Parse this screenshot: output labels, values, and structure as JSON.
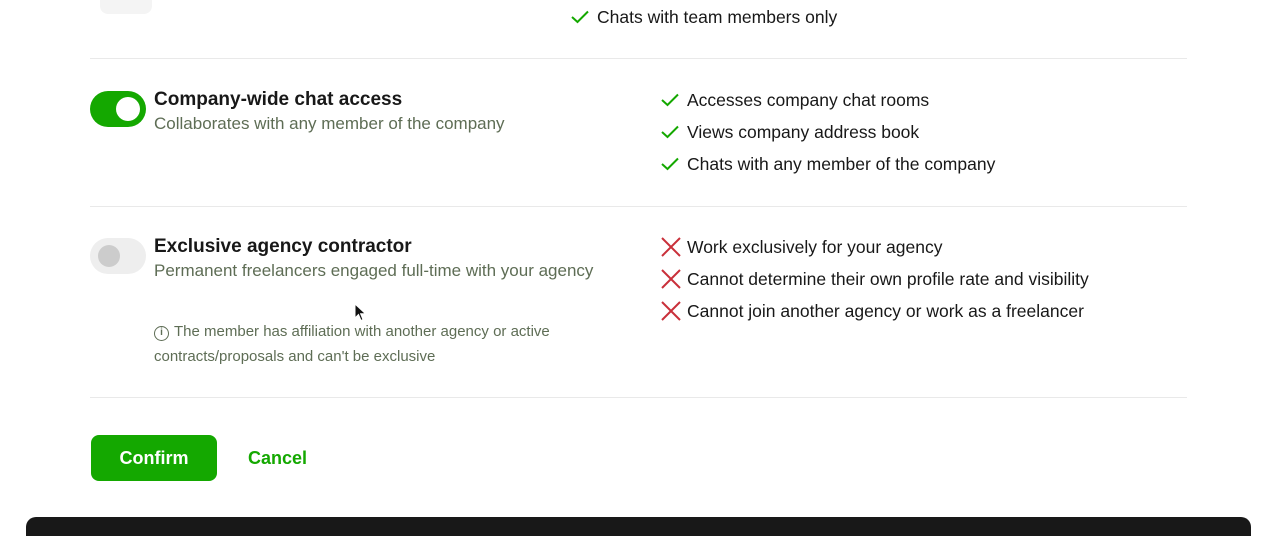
{
  "previous_section": {
    "features": [
      {
        "icon": "check-icon",
        "text": "Chats with team members only"
      }
    ]
  },
  "company_chat": {
    "toggle_state": "on",
    "title": "Company-wide chat access",
    "description": "Collaborates with any member of the company",
    "features": [
      {
        "icon": "check-icon",
        "text": "Accesses company chat rooms"
      },
      {
        "icon": "check-icon",
        "text": "Views company address book"
      },
      {
        "icon": "check-icon",
        "text": "Chats with any member of the company"
      }
    ]
  },
  "exclusive_contractor": {
    "toggle_state": "off",
    "title": "Exclusive agency contractor",
    "description": "Permanent freelancers engaged full-time with your agency",
    "note_icon": "info-icon",
    "note": "The member has affiliation with another agency or active contracts/proposals and can't be exclusive",
    "features": [
      {
        "icon": "cross-icon",
        "text": "Work exclusively for your agency"
      },
      {
        "icon": "cross-icon",
        "text": "Cannot determine their own profile rate and visibility"
      },
      {
        "icon": "cross-icon",
        "text": "Cannot join another agency or work as a freelancer"
      }
    ]
  },
  "actions": {
    "confirm_label": "Confirm",
    "cancel_label": "Cancel"
  },
  "colors": {
    "brand_green": "#14a800",
    "check_green": "#14a800",
    "cross_red": "#c9303a",
    "footer": "#181818"
  }
}
